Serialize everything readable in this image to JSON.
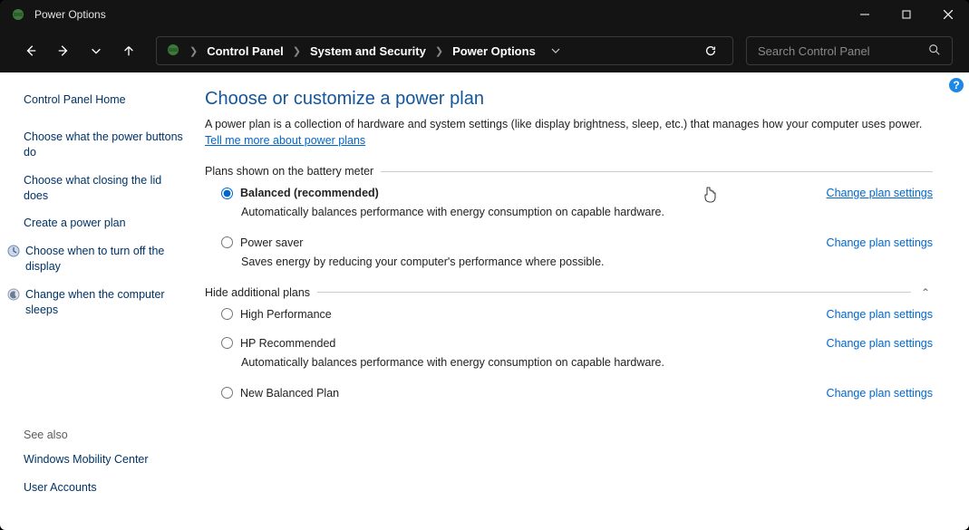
{
  "window_title": "Power Options",
  "breadcrumbs": [
    "Control Panel",
    "System and Security",
    "Power Options"
  ],
  "search_placeholder": "Search Control Panel",
  "help_badge": "?",
  "sidebar": {
    "home": "Control Panel Home",
    "links": {
      "power_buttons": "Choose what the power buttons do",
      "closing_lid": "Choose what closing the lid does",
      "create_plan": "Create a power plan",
      "turn_off_display": "Choose when to turn off the display",
      "computer_sleeps": "Change when the computer sleeps"
    },
    "see_also_heading": "See also",
    "see_also": {
      "mobility_center": "Windows Mobility Center",
      "user_accounts": "User Accounts"
    }
  },
  "main": {
    "heading": "Choose or customize a power plan",
    "intro": "A power plan is a collection of hardware and system settings (like display brightness, sleep, etc.) that manages how your computer uses power.",
    "intro_link": "Tell me more about power plans",
    "section_battery": "Plans shown on the battery meter",
    "section_hidden": "Hide additional plans",
    "change_link": "Change plan settings",
    "plans": {
      "balanced": {
        "label": "Balanced (recommended)",
        "desc": "Automatically balances performance with energy consumption on capable hardware."
      },
      "power_saver": {
        "label": "Power saver",
        "desc": "Saves energy by reducing your computer's performance where possible."
      },
      "high_perf": {
        "label": "High Performance"
      },
      "hp_recommended": {
        "label": "HP Recommended",
        "desc": "Automatically balances performance with energy consumption on capable hardware."
      },
      "new_balanced": {
        "label": "New Balanced Plan"
      }
    }
  }
}
